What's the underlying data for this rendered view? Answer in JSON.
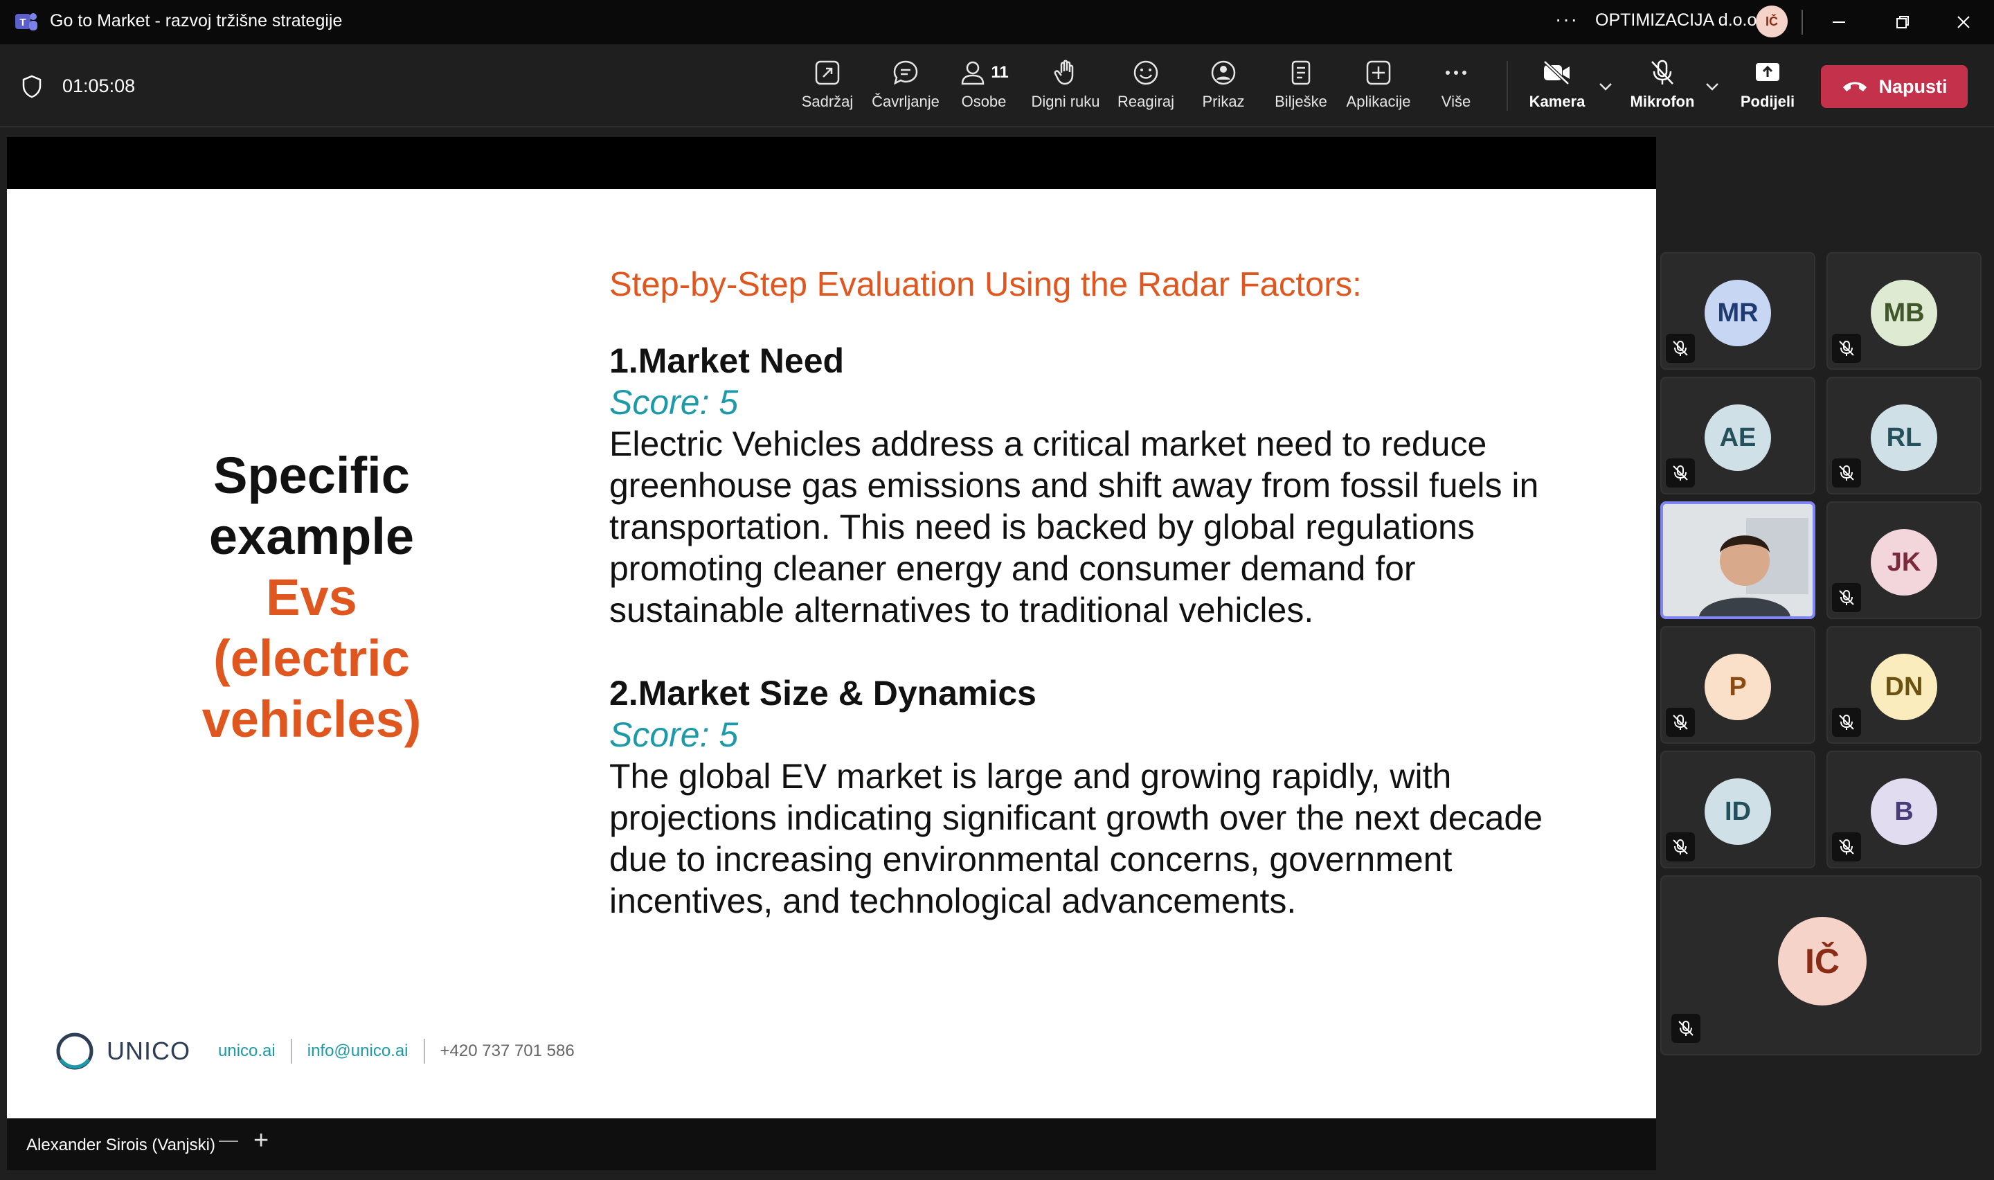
{
  "window": {
    "title": "Go to Market - razvoj tržišne strategije",
    "org": "OPTIMIZACIJA d.o.o.",
    "user_initials": "IČ",
    "more": "···"
  },
  "meeting": {
    "timer": "01:05:08"
  },
  "toolbar": {
    "content": "Sadržaj",
    "chat": "Čavrljanje",
    "people": "Osobe",
    "people_count": "11",
    "raise_hand": "Digni ruku",
    "react": "Reagiraj",
    "view": "Prikaz",
    "notes": "Bilješke",
    "apps": "Aplikacije",
    "more": "Više",
    "camera": "Kamera",
    "mic": "Mikrofon",
    "share": "Podijeli",
    "leave": "Napusti"
  },
  "slide": {
    "left_line1": "Specific",
    "left_line2": "example",
    "left_line3": "Evs",
    "left_line4": "(electric",
    "left_line5": "vehicles)",
    "heading": "Step-by-Step Evaluation Using the Radar Factors:",
    "sections": [
      {
        "title": "1.Market Need",
        "score_label": "Score",
        "score_value": ": 5",
        "body": "Electric Vehicles address a critical market need to reduce greenhouse gas emissions and shift away from fossil fuels in transportation. This need is backed by global regulations promoting cleaner energy and consumer demand for sustainable alternatives to traditional vehicles."
      },
      {
        "title": "2.Market Size & Dynamics",
        "score_label": "Score",
        "score_value": ": 5",
        "body": "The global EV market is large and growing rapidly, with projections indicating significant growth over the next decade due to increasing environmental concerns, government incentives, and technological advancements."
      }
    ],
    "footer": {
      "brand": "UNICO",
      "site": "unico.ai",
      "email": "info@unico.ai",
      "phone": "+420 737 701 586"
    }
  },
  "presenter": {
    "name": "Alexander Sirois (Vanjski)",
    "dash": "—",
    "plus": "+"
  },
  "participants": [
    {
      "initials": "MR",
      "bg": "#c7d6f3",
      "fg": "#1f3b73"
    },
    {
      "initials": "MB",
      "bg": "#dfead3",
      "fg": "#40572b"
    },
    {
      "initials": "AE",
      "bg": "#cfe0e6",
      "fg": "#24505c"
    },
    {
      "initials": "RL",
      "bg": "#cfe0e6",
      "fg": "#24505c"
    },
    {
      "initials": "",
      "bg": "",
      "fg": ""
    },
    {
      "initials": "JK",
      "bg": "#f2d6dc",
      "fg": "#7b2a3a"
    },
    {
      "initials": "P",
      "bg": "#fbe0c9",
      "fg": "#8a4a14"
    },
    {
      "initials": "DN",
      "bg": "#fbecbd",
      "fg": "#6b5210"
    },
    {
      "initials": "ID",
      "bg": "#cfe0e6",
      "fg": "#24505c"
    },
    {
      "initials": "B",
      "bg": "#e2dcf0",
      "fg": "#4a3c7a"
    },
    {
      "initials": "IČ",
      "bg": "#f6d3c9",
      "fg": "#8a2b15"
    }
  ]
}
